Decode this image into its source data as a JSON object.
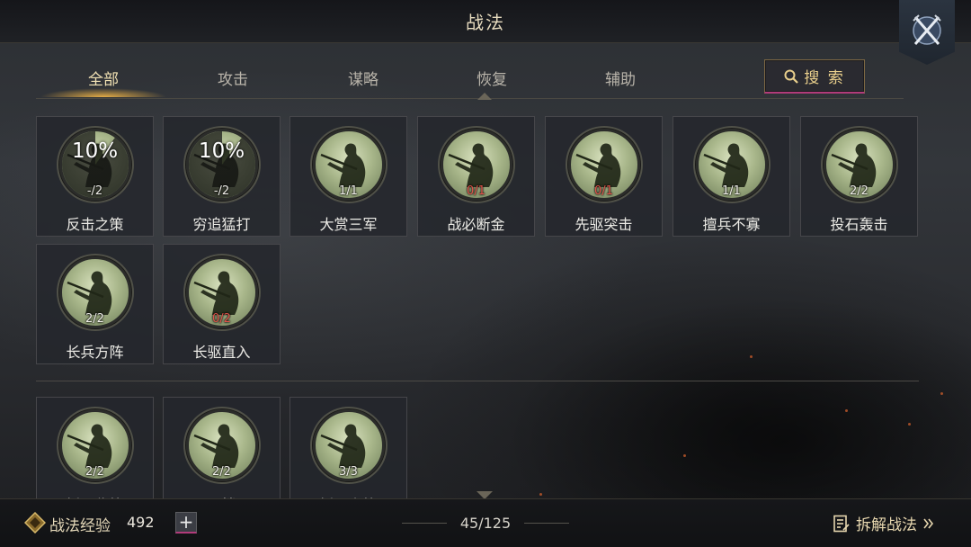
{
  "header": {
    "title": "战法"
  },
  "tabs": [
    {
      "label": "全部",
      "active": true
    },
    {
      "label": "攻击",
      "active": false
    },
    {
      "label": "谋略",
      "active": false
    },
    {
      "label": "恢复",
      "active": false
    },
    {
      "label": "辅助",
      "active": false
    }
  ],
  "search": {
    "label": "搜 索"
  },
  "cards": [
    {
      "name": "反击之策",
      "count": "-/2",
      "percent": "10%",
      "count_color": "white"
    },
    {
      "name": "穷追猛打",
      "count": "-/2",
      "percent": "10%",
      "count_color": "white"
    },
    {
      "name": "大赏三军",
      "count": "1/1",
      "count_color": "white"
    },
    {
      "name": "战必断金",
      "count": "0/1",
      "count_color": "red"
    },
    {
      "name": "先驱突击",
      "count": "0/1",
      "count_color": "red"
    },
    {
      "name": "擅兵不寡",
      "count": "1/1",
      "count_color": "white"
    },
    {
      "name": "投石轰击",
      "count": "2/2",
      "count_color": "white"
    },
    {
      "name": "长兵方阵",
      "count": "2/2",
      "count_color": "white"
    },
    {
      "name": "长驱直入",
      "count": "0/2",
      "count_color": "red"
    }
  ],
  "cards_second": [
    {
      "name": "援国秘策",
      "count": "2/2",
      "count_color": "white"
    },
    {
      "name": "二楼",
      "count": "2/2",
      "count_color": "white"
    },
    {
      "name": "援国之策",
      "count": "3/3",
      "count_color": "white"
    }
  ],
  "footer": {
    "exp_label": "战法经验",
    "exp_value": "492",
    "plus_label": "+",
    "page": "45/125",
    "dismantle_label": "拆解战法"
  },
  "colors": {
    "accent": "#e9cf8c",
    "red_count": "#e0544a",
    "tab_glow": "#f0b446"
  },
  "icons": {
    "close": "crossed-swords-icon",
    "search": "search-icon",
    "exp": "exp-badge-icon",
    "dismantle": "document-list-icon"
  }
}
